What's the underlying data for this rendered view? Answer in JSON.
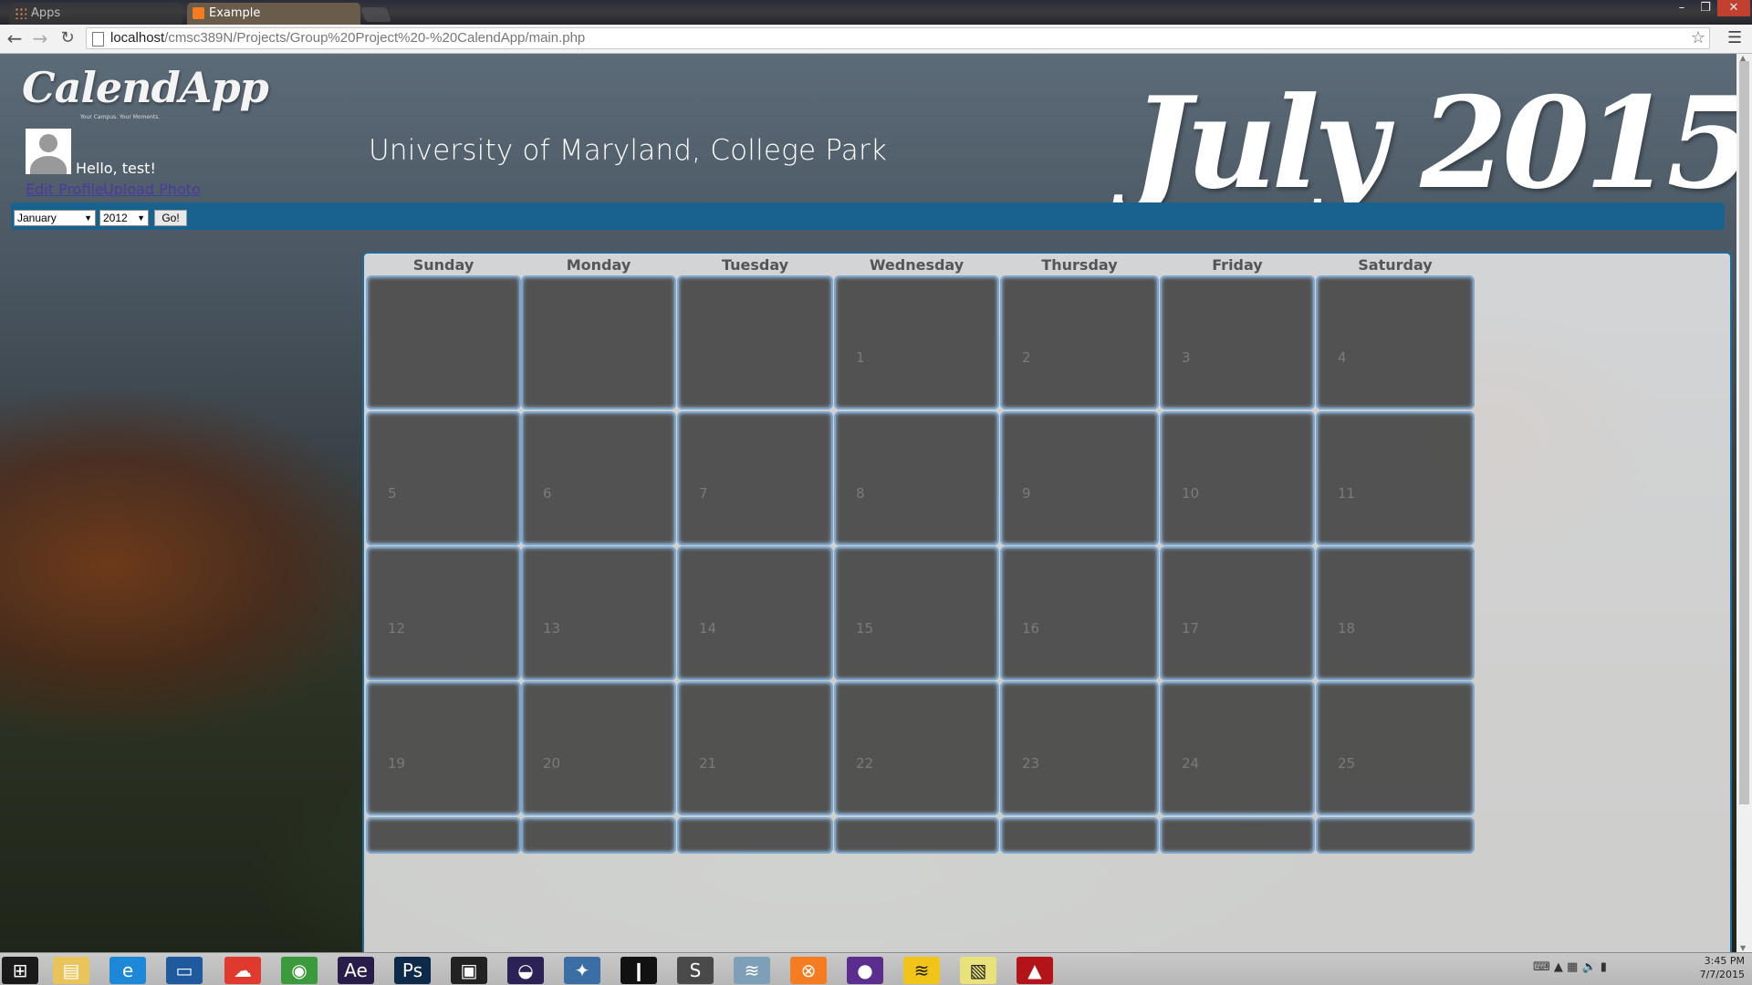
{
  "browser": {
    "tabs": [
      {
        "label": "Apps",
        "active": false
      },
      {
        "label": "Example",
        "active": true
      }
    ],
    "url_host": "localhost",
    "url_path": "/cmsc389N/Projects/Group%20Project%20-%20CalendApp/main.php",
    "window_buttons": {
      "minimize": "–",
      "maximize": "❐",
      "close": "✕"
    },
    "icons": {
      "back": "arrow-left-icon",
      "forward": "arrow-right-icon",
      "reload": "reload-icon",
      "star": "star-icon",
      "menu": "hamburger-menu-icon"
    }
  },
  "page": {
    "logo": "CalendApp",
    "tagline": "Your Campus. Your Moments.",
    "greeting": "Hello, test!",
    "edit_profile": "Edit Profile",
    "upload_photo": "Upload Photo",
    "university": "University of Maryland, College Park",
    "month_title": "July 2015",
    "accent_color": "#17628e",
    "nav": {
      "month_value": "January",
      "year_value": "2012",
      "go_label": "Go!"
    }
  },
  "calendar": {
    "weekdays": [
      "Sunday",
      "Monday",
      "Tuesday",
      "Wednesday",
      "Thursday",
      "Friday",
      "Saturday"
    ],
    "weeks": [
      [
        "",
        "",
        "",
        "1",
        "2",
        "3",
        "4"
      ],
      [
        "5",
        "6",
        "7",
        "8",
        "9",
        "10",
        "11"
      ],
      [
        "12",
        "13",
        "14",
        "15",
        "16",
        "17",
        "18"
      ],
      [
        "19",
        "20",
        "21",
        "22",
        "23",
        "24",
        "25"
      ]
    ]
  },
  "taskbar": {
    "apps": [
      "windows-start-icon",
      "file-explorer-icon",
      "internet-explorer-icon",
      "lenovo-app-icon",
      "cloud-app-icon",
      "chrome-icon",
      "after-effects-icon",
      "photoshop-icon",
      "video-editor-icon",
      "eclipse-icon",
      "python-icon",
      "command-prompt-icon",
      "sublime-text-icon",
      "wireshark-icon",
      "xampp-icon",
      "github-icon",
      "spotify-icon",
      "sticky-notes-icon",
      "acrobat-icon"
    ],
    "time": "3:45 PM",
    "date": "7/7/2015"
  }
}
